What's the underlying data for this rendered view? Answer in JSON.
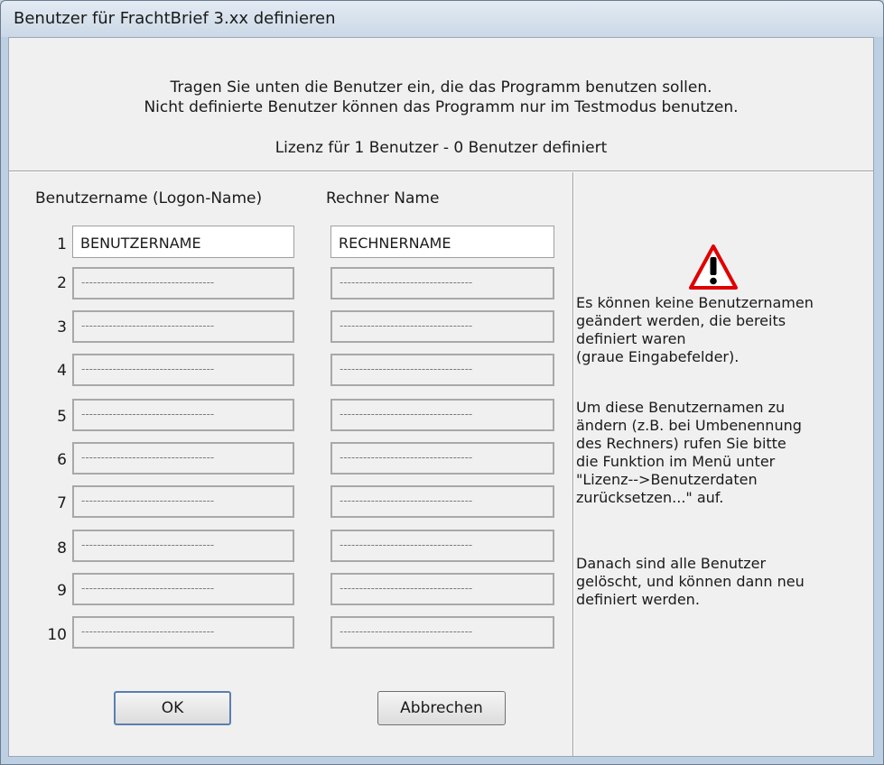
{
  "window": {
    "title": "Benutzer für FrachtBrief 3.xx definieren"
  },
  "intro": {
    "line1": "Tragen Sie unten die Benutzer ein, die das Programm benutzen sollen.",
    "line2": "Nicht definierte Benutzer können das Programm nur im Testmodus benutzen."
  },
  "license_text": "Lizenz für 1 Benutzer - 0 Benutzer definiert",
  "columns": {
    "username": "Benutzername (Logon-Name)",
    "computer": "Rechner Name"
  },
  "rows": [
    {
      "num": "1",
      "user": "BENUTZERNAME",
      "computer": "RECHNERNAME"
    },
    {
      "num": "2",
      "user": "----------------------------------",
      "computer": "----------------------------------"
    },
    {
      "num": "3",
      "user": "----------------------------------",
      "computer": "----------------------------------"
    },
    {
      "num": "4",
      "user": "----------------------------------",
      "computer": "----------------------------------"
    },
    {
      "num": "5",
      "user": "----------------------------------",
      "computer": "----------------------------------"
    },
    {
      "num": "6",
      "user": "----------------------------------",
      "computer": "----------------------------------"
    },
    {
      "num": "7",
      "user": "----------------------------------",
      "computer": "----------------------------------"
    },
    {
      "num": "8",
      "user": "----------------------------------",
      "computer": "----------------------------------"
    },
    {
      "num": "9",
      "user": "----------------------------------",
      "computer": "----------------------------------"
    },
    {
      "num": "10",
      "user": "----------------------------------",
      "computer": "----------------------------------"
    }
  ],
  "info": {
    "p1": [
      "Es können keine Benutzernamen",
      "geändert werden, die bereits",
      "definiert waren",
      "(graue Eingabefelder)."
    ],
    "p2": [
      "Um diese Benutzernamen zu",
      "ändern (z.B. bei Umbenennung",
      "des Rechners) rufen Sie bitte",
      "die Funktion im Menü unter",
      "\"Lizenz-->Benutzerdaten",
      "zurücksetzen...\" auf."
    ],
    "p3": [
      "Danach sind alle Benutzer",
      "gelöscht, und können dann neu",
      "definiert werden."
    ]
  },
  "buttons": {
    "ok": "OK",
    "cancel": "Abbrechen"
  },
  "icons": {
    "warning": "warning-triangle-icon"
  },
  "colors": {
    "warning_red": "#e00000",
    "field_border": "#a8a8a8"
  }
}
